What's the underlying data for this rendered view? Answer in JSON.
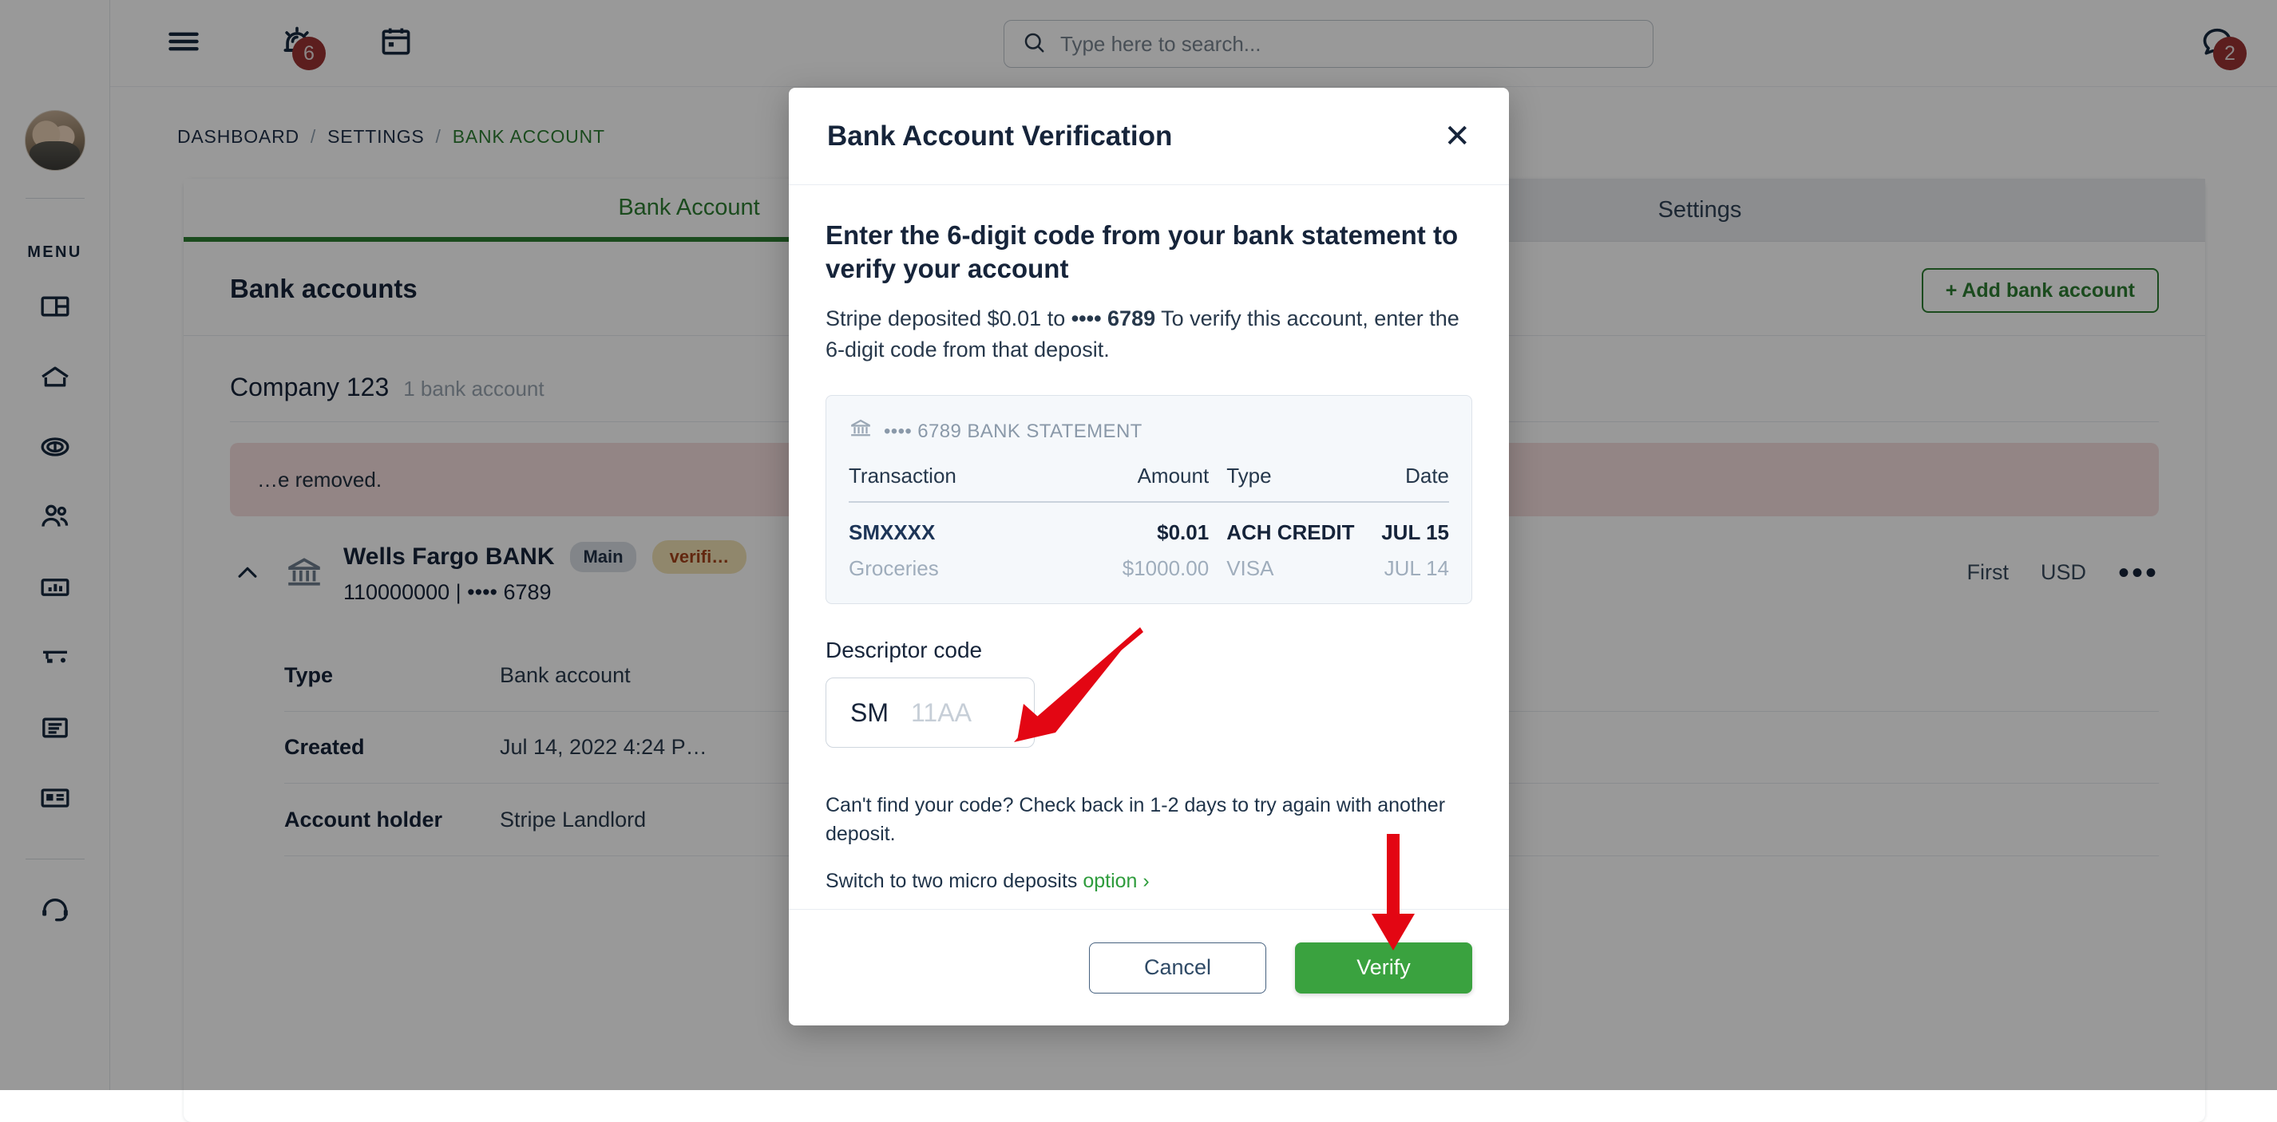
{
  "topbar": {
    "menu_icon": "hamburger-icon",
    "alarm_icon": "alarm-icon",
    "alarm_badge": "6",
    "calendar_icon": "calendar-icon",
    "search": {
      "placeholder": "Type here to search...",
      "value": "",
      "icon": "search-icon"
    },
    "chat_icon": "chat-bubble-icon",
    "chat_badge": "2",
    "settings_icon": "gear-icon"
  },
  "sidebar": {
    "avatar": "user-avatar",
    "menu_label": "MENU",
    "items": [
      {
        "icon": "dashboard-grid-icon"
      },
      {
        "icon": "home-icon"
      },
      {
        "icon": "money-coin-icon"
      },
      {
        "icon": "people-icon"
      },
      {
        "icon": "chart-bar-icon"
      },
      {
        "icon": "tools-icon"
      },
      {
        "icon": "document-icon"
      },
      {
        "icon": "id-card-icon"
      }
    ],
    "support": {
      "icon": "headset-support-icon"
    }
  },
  "breadcrumb": {
    "items": [
      "DASHBOARD",
      "SETTINGS",
      "BANK ACCOUNT"
    ],
    "separator": "/",
    "current_index": 2
  },
  "panel": {
    "tabs": [
      {
        "label": "Bank Account",
        "active": true
      },
      {
        "label": "Settings",
        "active": false
      }
    ],
    "title": "Bank accounts",
    "add_button": "+ Add bank account",
    "company": {
      "name": "Company 123",
      "subtitle": "1 bank account"
    },
    "alert": "…e removed.",
    "account": {
      "chevron": "chevron-up-icon",
      "bank_icon": "bank-icon",
      "name": "Wells Fargo BANK",
      "badge_main": "Main",
      "badge_status": "verifi…",
      "number": "110000000 | •••• 6789",
      "meta_order": "First",
      "meta_currency": "USD",
      "menu": "•••"
    },
    "details": [
      {
        "key": "Type",
        "value": "Bank account"
      },
      {
        "key": "Created",
        "value": "Jul 14, 2022 4:24 P…"
      },
      {
        "key": "Account holder",
        "value": "Stripe Landlord"
      }
    ]
  },
  "modal": {
    "title": "Bank Account Verification",
    "close_icon": "close-icon",
    "heading": "Enter the 6-digit code from your bank statement to verify your account",
    "body_pre": "Stripe deposited $0.01 to ",
    "body_masked": "•••• 6789",
    "body_post": " To verify this account, enter the 6-digit code from that deposit.",
    "statement": {
      "icon": "bank-icon",
      "label": "•••• 6789 BANK STATEMENT",
      "columns": [
        "Transaction",
        "Amount",
        "Type",
        "Date"
      ],
      "rows": [
        {
          "transaction": "SMXXXX",
          "amount": "$0.01",
          "type": "ACH CREDIT",
          "date": "JUL 15",
          "highlight": true
        },
        {
          "transaction": "Groceries",
          "amount": "$1000.00",
          "type": "VISA",
          "date": "JUL 14",
          "highlight": false
        }
      ]
    },
    "field_label": "Descriptor code",
    "code_prefix": "SM",
    "code_placeholder": "11AA",
    "code_value": "",
    "note": "Can't find your code? Check back in 1-2 days to try again with another deposit.",
    "switch_text": "Switch to two micro deposits ",
    "switch_link": "option ›",
    "cancel_label": "Cancel",
    "verify_label": "Verify"
  },
  "annotations": {
    "arrow_to_code_input": "red-arrow-pointing-to-descriptor-code-input",
    "arrow_to_verify_button": "red-arrow-pointing-to-verify-button",
    "color": "#e30613"
  }
}
